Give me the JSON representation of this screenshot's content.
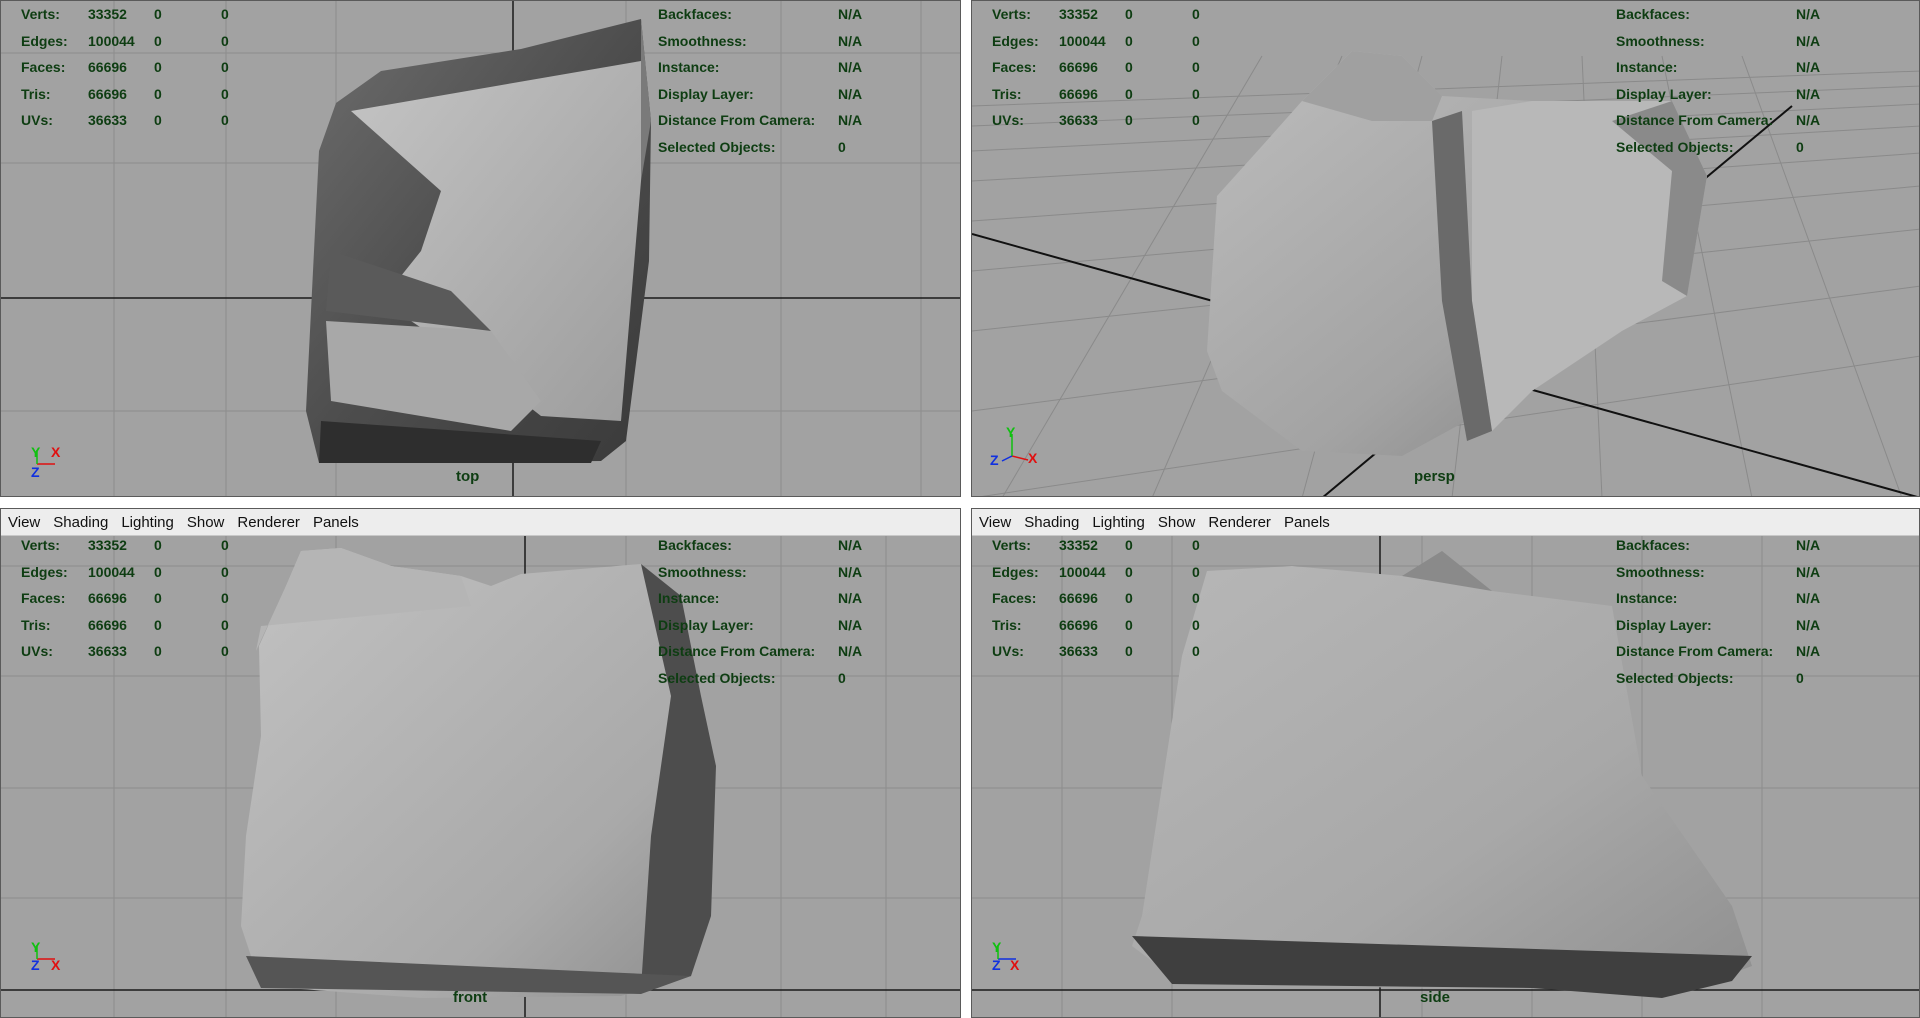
{
  "menu": [
    "View",
    "Shading",
    "Lighting",
    "Show",
    "Renderer",
    "Panels"
  ],
  "stats": [
    {
      "label": "Verts:",
      "v": "33352",
      "a": "0",
      "b": "0"
    },
    {
      "label": "Edges:",
      "v": "100044",
      "a": "0",
      "b": "0"
    },
    {
      "label": "Faces:",
      "v": "66696",
      "a": "0",
      "b": "0"
    },
    {
      "label": "Tris:",
      "v": "66696",
      "a": "0",
      "b": "0"
    },
    {
      "label": "UVs:",
      "v": "36633",
      "a": "0",
      "b": "0"
    }
  ],
  "info": [
    {
      "label": "Backfaces:",
      "value": "N/A"
    },
    {
      "label": "Smoothness:",
      "value": "N/A"
    },
    {
      "label": "Instance:",
      "value": "N/A"
    },
    {
      "label": "Display Layer:",
      "value": "N/A"
    },
    {
      "label": "Distance From Camera:",
      "value": "N/A"
    },
    {
      "label": "Selected Objects:",
      "value": "0"
    }
  ],
  "cameras": {
    "top": "top",
    "persp": "persp",
    "front": "front",
    "side": "side"
  },
  "axes": {
    "x": "X",
    "y": "Y",
    "z": "Z"
  },
  "colors": {
    "viewport_bg": "#a2a2a2",
    "hud_text": "#0e3d12",
    "axis_x": "#e01010",
    "axis_y": "#10c010",
    "axis_z": "#1030e0",
    "menubar_bg": "#ededed"
  }
}
